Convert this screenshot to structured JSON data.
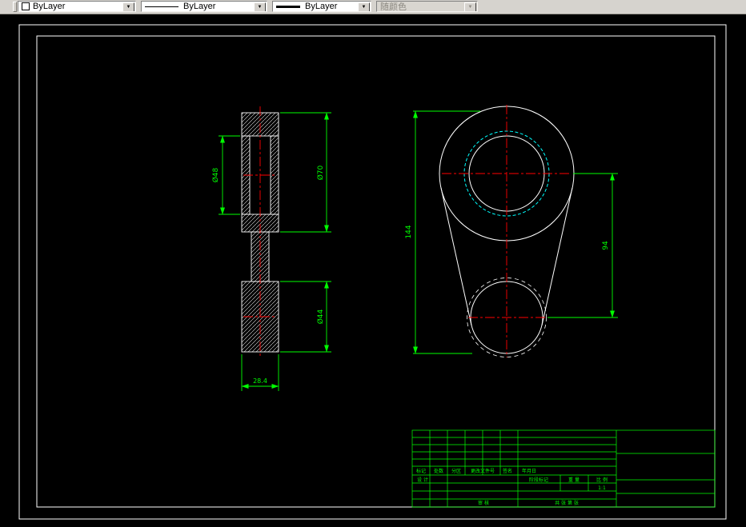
{
  "toolbar": {
    "color": {
      "value": "ByLayer"
    },
    "linetype": {
      "value": "ByLayer"
    },
    "lineweight": {
      "value": "ByLayer"
    },
    "plotstyle": {
      "value": "随颜色"
    }
  },
  "drawing": {
    "section_view": {
      "dim_bore": "Ø48",
      "dim_outer": "Ø70",
      "dim_lower": "Ø44",
      "dim_width": "28.4"
    },
    "front_view": {
      "dim_height": "144",
      "dim_center_distance": "94"
    }
  },
  "title_block": {
    "revision_header": [
      "标记",
      "处数",
      "分区",
      "更改文件号",
      "签名",
      "年月日"
    ],
    "design_label": "设 计",
    "review_label": "审 核",
    "stage_label": "阶段标记",
    "weight_label": "重 量",
    "scale_label": "比 例",
    "scale_value": "1:1",
    "sheets_label": "共 张 第 张"
  },
  "colors": {
    "dimension_green": "#00ff00",
    "centerline_red": "#ff0000",
    "outline_white": "#ffffff",
    "thread_cyan": "#00ffff"
  }
}
